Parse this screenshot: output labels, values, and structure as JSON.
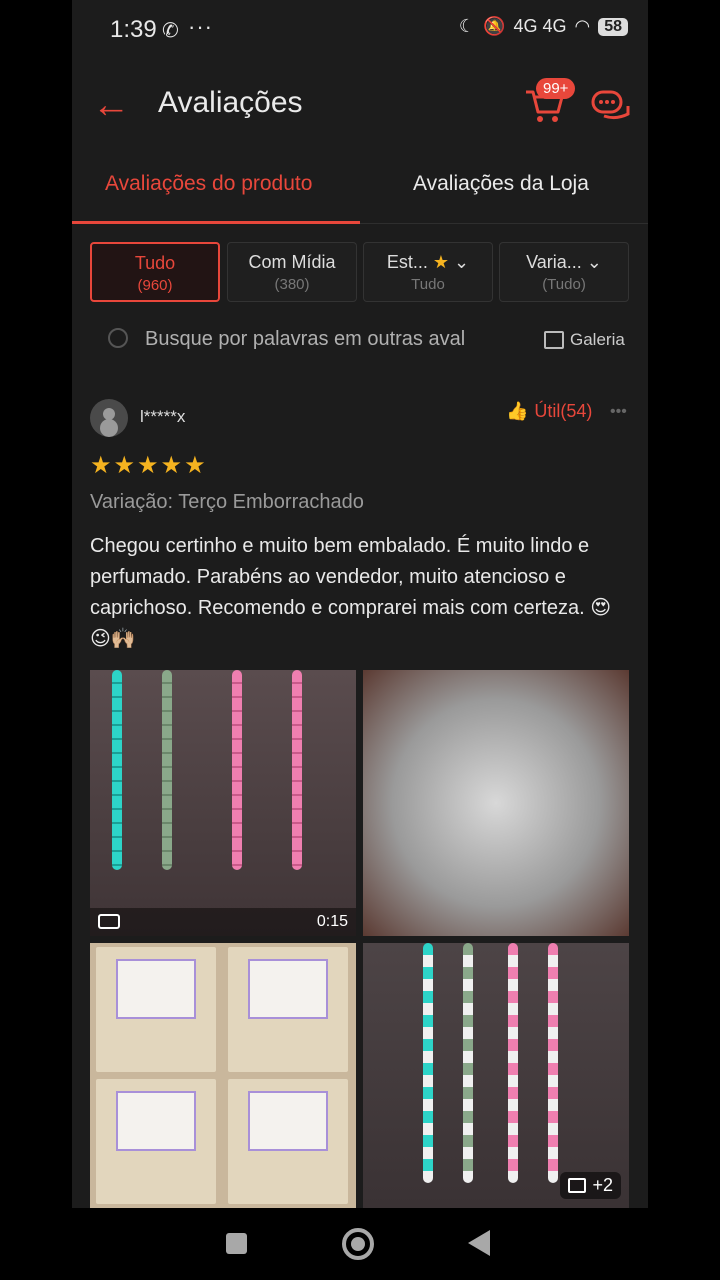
{
  "status_bar": {
    "time": "1:39",
    "dots": "···",
    "network": "4G 4G",
    "battery": "58"
  },
  "header": {
    "title": "Avaliações",
    "cart_badge": "99+"
  },
  "tabs": [
    {
      "label": "Avaliações do produto",
      "active": true
    },
    {
      "label": "Avaliações da Loja",
      "active": false
    }
  ],
  "filters": [
    {
      "label": "Tudo",
      "sub": "(960)",
      "selected": true
    },
    {
      "label": "Com Mídia",
      "sub": "(380)",
      "selected": false
    },
    {
      "label": "Est...",
      "sub": "Tudo",
      "selected": false
    },
    {
      "label": "Varia...",
      "sub": "(Tudo)",
      "selected": false
    }
  ],
  "search": {
    "placeholder": "Busque por palavras em outras aval",
    "gallery_label": "Galeria"
  },
  "review": {
    "username": "l*****x",
    "helpful": "Útil(54)",
    "stars": "★★★★★",
    "rating": 5,
    "variation": "Variação: Terço Emborrachado",
    "comment": "Chegou certinho e muito bem embalado. É muito lindo e perfumado. Parabéns ao vendedor, muito atencioso e caprichoso. Recomendo e comprarei mais com certeza. 😍😉🙌🏼",
    "video_duration": "0:15",
    "more_media": "+2"
  },
  "colors": {
    "accent": "#e8473b",
    "background": "#1c1c1c",
    "star": "#f5b320"
  }
}
